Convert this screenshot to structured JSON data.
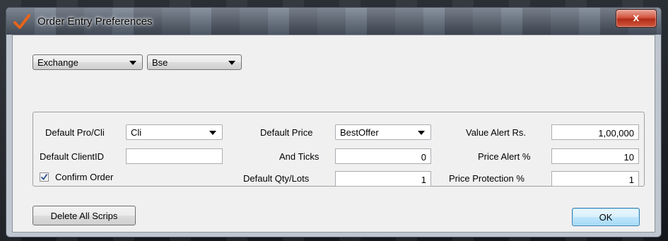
{
  "window": {
    "title": "Order Entry Preferences",
    "close_label": "x",
    "icon": "checkmark-icon",
    "icon_color": "#e8641a"
  },
  "top": {
    "exchange_type": "Exchange",
    "exchange_value": "Bse"
  },
  "form": {
    "pro_cli_label": "Default Pro/Cli",
    "pro_cli_value": "Cli",
    "client_id_label": "Default ClientID",
    "client_id_value": "",
    "confirm_order_label": "Confirm Order",
    "confirm_order_checked": true,
    "default_price_label": "Default Price",
    "default_price_value": "BestOffer",
    "and_ticks_label": "And Ticks",
    "and_ticks_value": "0",
    "default_qty_label": "Default Qty/Lots",
    "default_qty_value": "1",
    "value_alert_label": "Value Alert Rs.",
    "value_alert_value": "1,00,000",
    "price_alert_label": "Price Alert %",
    "price_alert_value": "10",
    "price_protection_label": "Price Protection %",
    "price_protection_value": "1"
  },
  "buttons": {
    "delete_all_label": "Delete All Scrips",
    "ok_label": "OK"
  }
}
